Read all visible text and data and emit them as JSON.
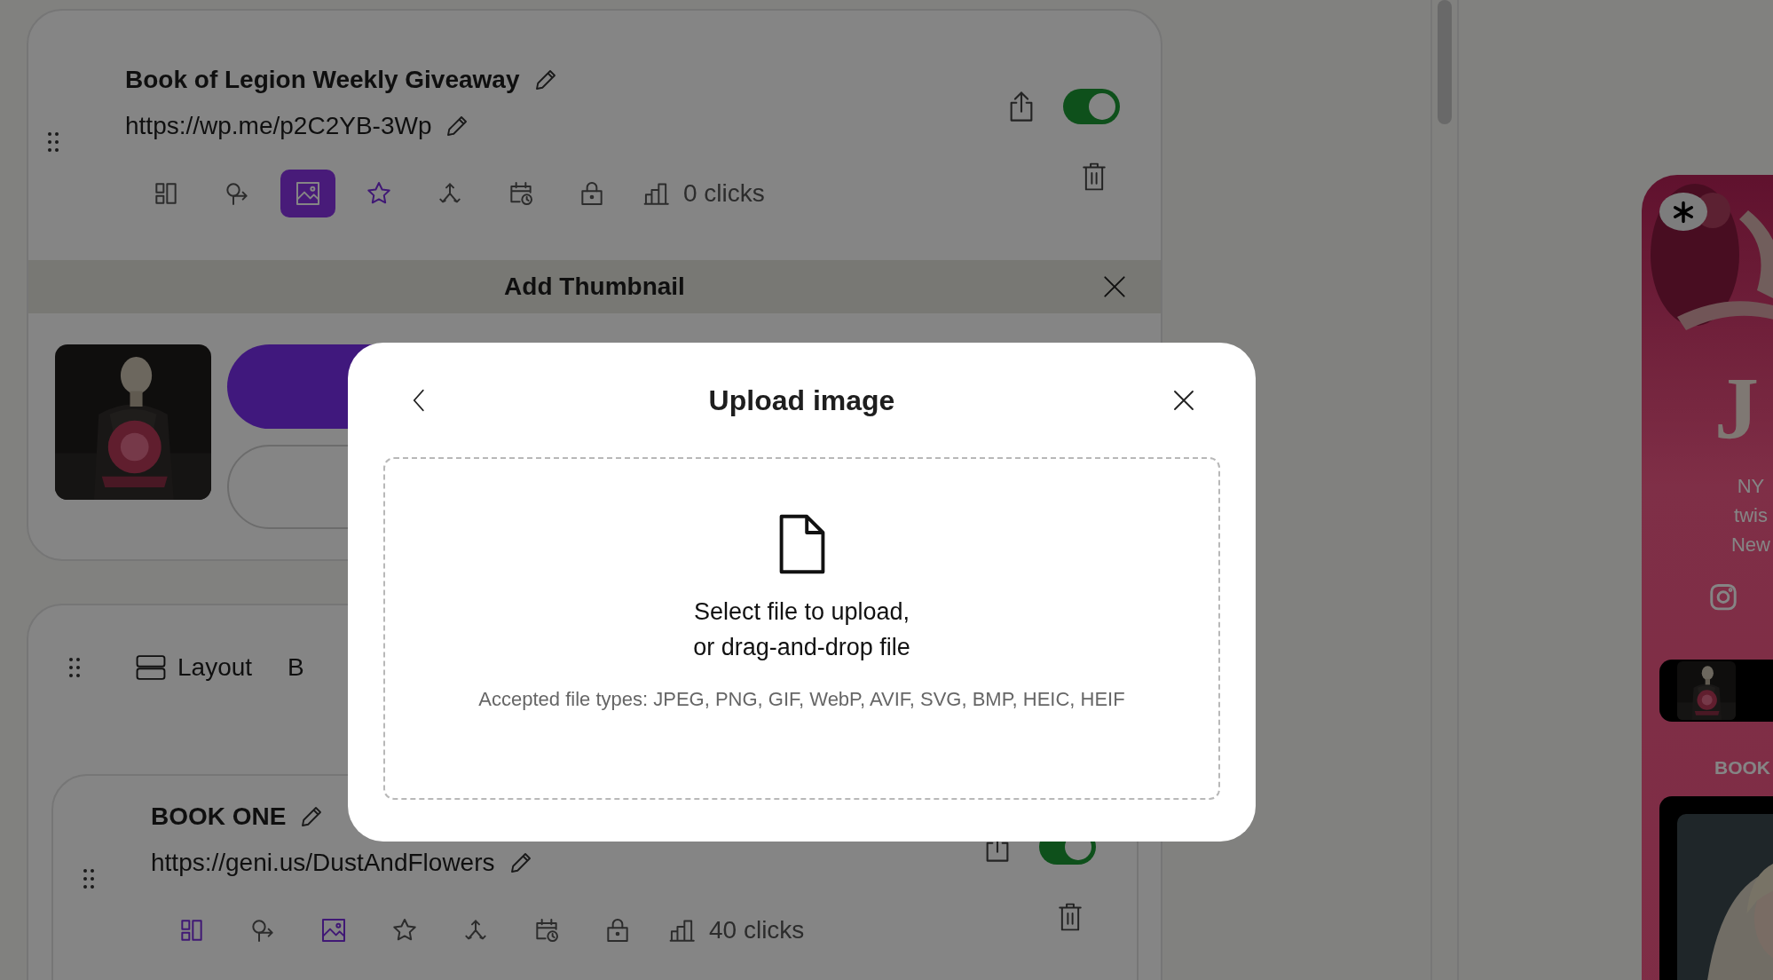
{
  "links": [
    {
      "title": "Book of Legion Weekly Giveaway",
      "url": "https://wp.me/p2C2YB-3Wp",
      "on": true,
      "clicks": "0 clicks",
      "tools": [
        {
          "kind": "layout",
          "active": false,
          "selected": false
        },
        {
          "kind": "redirect",
          "active": false,
          "selected": false
        },
        {
          "kind": "thumbnail",
          "active": true,
          "selected": true
        },
        {
          "kind": "priority",
          "active": true,
          "selected": false
        },
        {
          "kind": "split",
          "active": false,
          "selected": false
        },
        {
          "kind": "schedule",
          "active": false,
          "selected": false
        },
        {
          "kind": "lock",
          "active": false,
          "selected": false
        }
      ],
      "panel": {
        "title": "Add Thumbnail"
      }
    }
  ],
  "collection": {
    "tabs": [
      {
        "kind": "layout",
        "label": "Layout"
      },
      {
        "kind": "plain",
        "label": "B"
      }
    ],
    "links": [
      {
        "title": "BOOK ONE",
        "url": "https://geni.us/DustAndFlowers",
        "on": true,
        "clicks": "40 clicks",
        "tools": [
          {
            "kind": "layout",
            "active": true,
            "selected": false
          },
          {
            "kind": "redirect",
            "active": false,
            "selected": false
          },
          {
            "kind": "thumbnail",
            "active": true,
            "selected": false
          },
          {
            "kind": "priority",
            "active": false,
            "selected": false
          },
          {
            "kind": "split",
            "active": false,
            "selected": false
          },
          {
            "kind": "schedule",
            "active": false,
            "selected": false
          },
          {
            "kind": "lock",
            "active": false,
            "selected": false
          }
        ]
      }
    ]
  },
  "preview": {
    "title": "J",
    "bio_lines": [
      "NY",
      "twis",
      "New"
    ],
    "section_heading": "BOOK"
  },
  "modal": {
    "title": "Upload image",
    "prompt": "Select file to upload,\nor drag-and-drop file",
    "accepted_types": "Accepted file types: JPEG, PNG, GIF, WebP, AVIF, SVG, BMP, HEIC, HEIF"
  }
}
